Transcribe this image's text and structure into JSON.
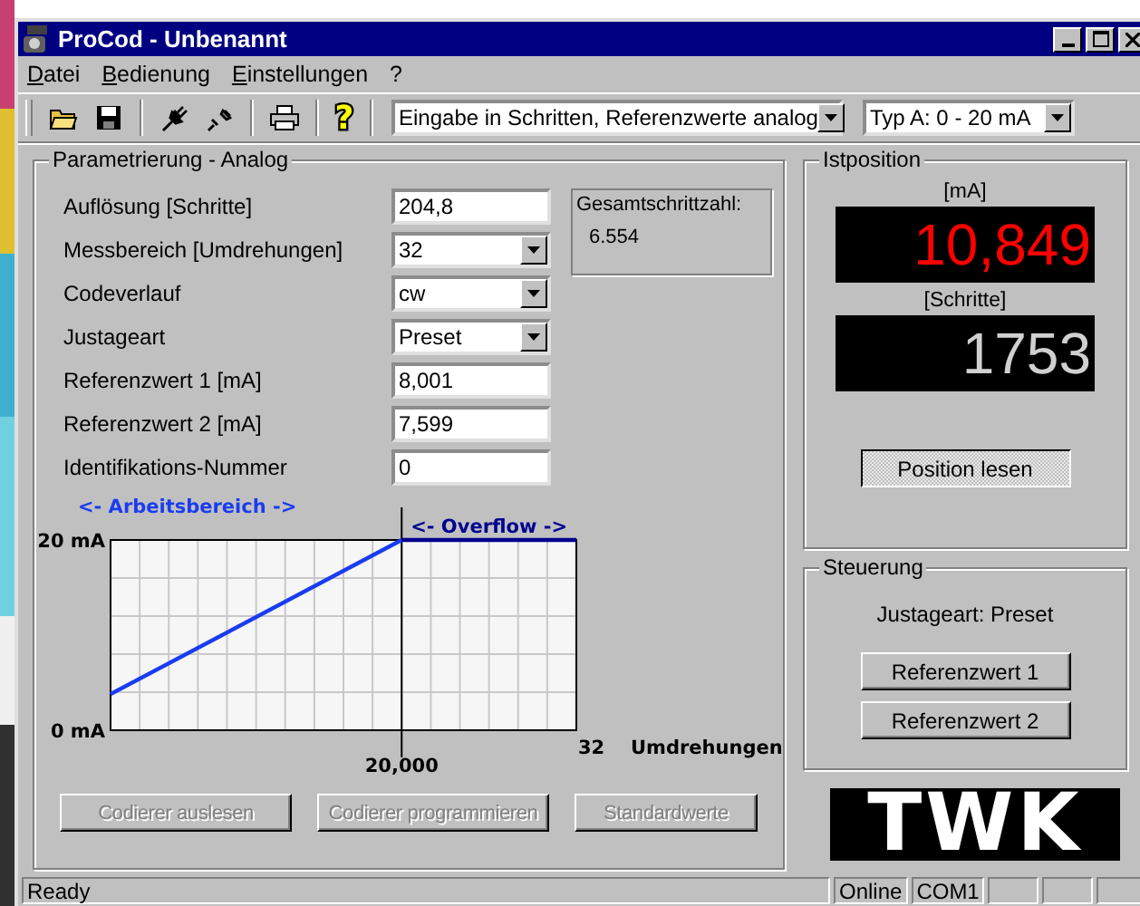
{
  "window": {
    "title": "ProCod - Unbenannt"
  },
  "menu": [
    {
      "label": "Datei"
    },
    {
      "label": "Bedienung"
    },
    {
      "label": "Einstellungen"
    },
    {
      "label": "?"
    }
  ],
  "toolbar": {
    "help": "?",
    "mode_select": "Eingabe in Schritten, Referenzwerte analog",
    "type_select": "Typ A: 0 - 20 mA"
  },
  "parameter_group": {
    "title": "Parametrierung - Analog",
    "fields": [
      {
        "label": "Auflösung [Schritte]",
        "kind": "text",
        "value": "204,8"
      },
      {
        "label": "Messbereich [Umdrehungen]",
        "kind": "dropdown",
        "value": "32"
      },
      {
        "label": "Codeverlauf",
        "kind": "dropdown",
        "value": "cw"
      },
      {
        "label": "Justageart",
        "kind": "dropdown",
        "value": "Preset"
      },
      {
        "label": "Referenzwert 1 [mA]",
        "kind": "text",
        "value": "8,001"
      },
      {
        "label": "Referenzwert 2 [mA]",
        "kind": "text",
        "value": "7,599"
      },
      {
        "label": "Identifikations-Nummer",
        "kind": "text",
        "value": "0"
      }
    ],
    "total": {
      "label": "Gesamtschrittzahl:",
      "value": "6.554"
    },
    "diagram": {
      "range_label": "<- Arbeitsbereich ->",
      "overflow_label": "<- Overflow ->",
      "y_labels": [
        "20 mA",
        "0 mA"
      ],
      "x_labels": [
        "20,000",
        "32"
      ],
      "x_title": "Umdrehungen"
    },
    "buttons": [
      {
        "label": "Codierer auslesen",
        "disabled": true
      },
      {
        "label": "Codierer programmieren",
        "disabled": true
      },
      {
        "label": "Standardwerte",
        "disabled": true
      }
    ]
  },
  "position_group": {
    "title": "Istposition",
    "displays": [
      {
        "label": "[mA]",
        "value": "10,849",
        "color": "#ff0000"
      },
      {
        "label": "[Schritte]",
        "value": "1753",
        "color": "#d0d0d0"
      }
    ],
    "read_button": {
      "label": "Position lesen",
      "focused": true
    }
  },
  "control_group": {
    "title": "Steuerung",
    "info": "Justageart: Preset",
    "buttons": [
      {
        "label": "Referenzwert 1",
        "focused": false
      },
      {
        "label": "Referenzwert 2",
        "focused": false
      }
    ]
  },
  "logo": {
    "text": "TWK"
  },
  "status_bar": {
    "message": "Ready",
    "panes": [
      {
        "kind": "text",
        "label": "Online"
      },
      {
        "kind": "text",
        "label": "COM1"
      },
      {
        "kind": "empty"
      },
      {
        "kind": "empty"
      },
      {
        "kind": "empty"
      }
    ]
  }
}
